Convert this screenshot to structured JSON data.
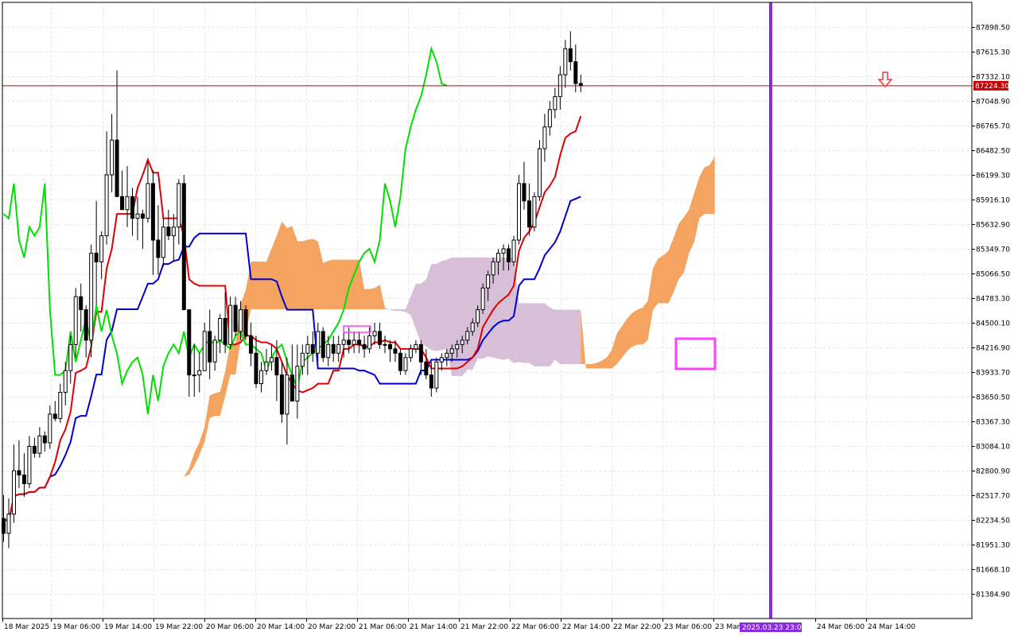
{
  "chart_data": {
    "type": "candlestick",
    "grid": true,
    "ylim": [
      81101.0,
      88182.0
    ],
    "y_ticks": [
      "87898.50",
      "87615.30",
      "87332.10",
      "87048.90",
      "86765.70",
      "86482.50",
      "86199.30",
      "85916.10",
      "85632.90",
      "85349.70",
      "85066.50",
      "84783.30",
      "84500.10",
      "84216.90",
      "83933.70",
      "83650.50",
      "83367.30",
      "83084.10",
      "82800.90",
      "82517.70",
      "82234.50",
      "81951.30",
      "81668.10",
      "81384.90"
    ],
    "x_ticks": [
      "18 Mar 2025",
      "19 Mar 06:00",
      "19 Mar 14:00",
      "19 Mar 22:00",
      "20 Mar 06:00",
      "20 Mar 14:00",
      "20 Mar 22:00",
      "21 Mar 06:00",
      "21 Mar 14:00",
      "21 Mar 22:00",
      "22 Mar 06:00",
      "22 Mar 14:00",
      "22 Mar 22:00",
      "23 Mar 06:00",
      "23 Mar",
      "24 Mar 06:00",
      "24 Mar 14:00"
    ],
    "current_price": "87224.30",
    "cursor_time": "2025.03.23 23:00",
    "colors": {
      "tenkan": "#e00000",
      "kijun": "#0000cc",
      "chikou": "#00e000",
      "kumo_bull": "#f4a460",
      "kumo_bear": "#d8bfd8",
      "price_line": "#c00000",
      "cursor": "#8a2be2",
      "marker_box": "#ff40ff",
      "arrow": "#ff3030",
      "grid": "#e4e4e4",
      "candle_bull_border": "#000000",
      "candle_bear_fill": "#000000"
    },
    "candles": [
      [
        82250,
        82520,
        81980,
        82080
      ],
      [
        82080,
        82480,
        81910,
        82300
      ],
      [
        82300,
        83100,
        82200,
        82800
      ],
      [
        82800,
        83150,
        82600,
        82750
      ],
      [
        82750,
        83000,
        82500,
        82650
      ],
      [
        82650,
        83200,
        82600,
        83080
      ],
      [
        83080,
        83180,
        82950,
        83000
      ],
      [
        83000,
        83300,
        82950,
        83200
      ],
      [
        83200,
        83250,
        83020,
        83120
      ],
      [
        83120,
        83550,
        83050,
        83450
      ],
      [
        83450,
        83600,
        83370,
        83400
      ],
      [
        83400,
        83800,
        83350,
        83700
      ],
      [
        83700,
        84050,
        83550,
        83950
      ],
      [
        83950,
        84350,
        83800,
        84250
      ],
      [
        84250,
        84900,
        84100,
        84800
      ],
      [
        84800,
        84950,
        84400,
        84650
      ],
      [
        84650,
        84700,
        84100,
        84300
      ],
      [
        84300,
        85400,
        84100,
        85300
      ],
      [
        85300,
        85900,
        84700,
        85200
      ],
      [
        85200,
        85550,
        85000,
        85500
      ],
      [
        85500,
        86700,
        85400,
        86200
      ],
      [
        86200,
        86900,
        86000,
        86600
      ],
      [
        86600,
        87400,
        85950,
        85950
      ],
      [
        85950,
        86250,
        85800,
        85800
      ],
      [
        85800,
        86300,
        85600,
        85950
      ],
      [
        85950,
        86050,
        85500,
        85700
      ],
      [
        85700,
        85950,
        85450,
        85750
      ],
      [
        85750,
        85800,
        85350,
        85700
      ],
      [
        85700,
        86350,
        85650,
        86100
      ],
      [
        86100,
        86250,
        85050,
        85450
      ],
      [
        85450,
        85850,
        85050,
        85250
      ],
      [
        85250,
        85700,
        85150,
        85600
      ],
      [
        85600,
        85800,
        85450,
        85500
      ],
      [
        85500,
        85750,
        85200,
        85600
      ],
      [
        85600,
        86150,
        85400,
        86100
      ],
      [
        86100,
        86200,
        84650,
        84650
      ],
      [
        84650,
        84650,
        83650,
        83900
      ],
      [
        83900,
        84250,
        83650,
        83900
      ],
      [
        83900,
        84150,
        83700,
        83950
      ],
      [
        83950,
        84500,
        83950,
        84400
      ],
      [
        84400,
        84650,
        83850,
        84050
      ],
      [
        84050,
        84350,
        83950,
        84300
      ],
      [
        84300,
        84600,
        84150,
        84550
      ],
      [
        84550,
        84850,
        84150,
        84250
      ],
      [
        84250,
        84800,
        84200,
        84700
      ],
      [
        84700,
        84800,
        84350,
        84400
      ],
      [
        84400,
        84750,
        84300,
        84650
      ],
      [
        84650,
        84700,
        84300,
        84350
      ],
      [
        84350,
        84500,
        84000,
        84150
      ],
      [
        84150,
        84350,
        83750,
        83800
      ],
      [
        83800,
        84050,
        83700,
        83950
      ],
      [
        83950,
        84200,
        83900,
        84050
      ],
      [
        84050,
        84250,
        83950,
        84100
      ],
      [
        84100,
        84300,
        83600,
        83900
      ],
      [
        83900,
        84050,
        83350,
        83450
      ],
      [
        83450,
        84100,
        83100,
        83900
      ],
      [
        83900,
        84250,
        83600,
        83600
      ],
      [
        83600,
        84250,
        83400,
        84000
      ],
      [
        84000,
        84250,
        83900,
        84150
      ],
      [
        84150,
        84350,
        83900,
        84250
      ],
      [
        84250,
        84400,
        84050,
        84150
      ],
      [
        84150,
        84500,
        84050,
        84400
      ],
      [
        84400,
        84450,
        84050,
        84100
      ],
      [
        84100,
        84350,
        84000,
        84250
      ],
      [
        84250,
        84350,
        84050,
        84150
      ],
      [
        84150,
        84350,
        84050,
        84250
      ],
      [
        84250,
        84400,
        84100,
        84300
      ],
      [
        84300,
        84450,
        84150,
        84250
      ],
      [
        84250,
        84400,
        84150,
        84300
      ],
      [
        84300,
        84400,
        84150,
        84250
      ],
      [
        84250,
        84350,
        84100,
        84200
      ],
      [
        84200,
        84450,
        84150,
        84350
      ],
      [
        84350,
        84500,
        84250,
        84400
      ],
      [
        84400,
        84500,
        84200,
        84250
      ],
      [
        84250,
        84350,
        84150,
        84250
      ],
      [
        84250,
        84300,
        84050,
        84200
      ],
      [
        84200,
        84300,
        84050,
        84150
      ],
      [
        84150,
        84200,
        83900,
        83950
      ],
      [
        83950,
        84150,
        83900,
        84100
      ],
      [
        84100,
        84250,
        84050,
        84200
      ],
      [
        84200,
        84300,
        84150,
        84250
      ],
      [
        84250,
        84300,
        83900,
        84050
      ],
      [
        84050,
        84200,
        83850,
        83900
      ],
      [
        83900,
        84050,
        83650,
        83750
      ],
      [
        83750,
        84100,
        83700,
        84050
      ],
      [
        84050,
        84150,
        83950,
        84100
      ],
      [
        84100,
        84200,
        84000,
        84150
      ],
      [
        84150,
        84250,
        84050,
        84200
      ],
      [
        84200,
        84300,
        84100,
        84250
      ],
      [
        84250,
        84350,
        84150,
        84300
      ],
      [
        84300,
        84450,
        84250,
        84400
      ],
      [
        84400,
        84550,
        84350,
        84500
      ],
      [
        84500,
        84700,
        84450,
        84650
      ],
      [
        84650,
        84950,
        84600,
        84900
      ],
      [
        84900,
        85100,
        84750,
        85050
      ],
      [
        85050,
        85250,
        84950,
        85200
      ],
      [
        85200,
        85350,
        85050,
        85300
      ],
      [
        85300,
        85400,
        85100,
        85350
      ],
      [
        85350,
        85400,
        85100,
        85200
      ],
      [
        85200,
        85500,
        85150,
        85450
      ],
      [
        85450,
        86200,
        85400,
        86100
      ],
      [
        86100,
        86350,
        85800,
        85900
      ],
      [
        85900,
        86100,
        85500,
        85600
      ],
      [
        85600,
        86000,
        85550,
        85950
      ],
      [
        85950,
        86600,
        85900,
        86500
      ],
      [
        86500,
        86900,
        86350,
        86750
      ],
      [
        86750,
        87050,
        86650,
        86950
      ],
      [
        86950,
        87200,
        86850,
        87100
      ],
      [
        87100,
        87450,
        86950,
        87350
      ],
      [
        87350,
        87750,
        87200,
        87650
      ],
      [
        87650,
        87850,
        87400,
        87500
      ],
      [
        87500,
        87700,
        87150,
        87250
      ],
      [
        87250,
        87350,
        87150,
        87224.3
      ]
    ]
  }
}
